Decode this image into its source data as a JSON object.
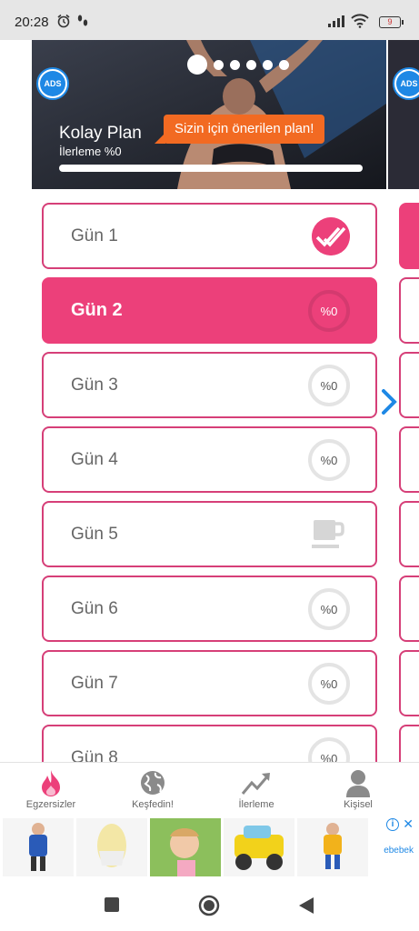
{
  "status_bar": {
    "time": "20:28",
    "battery": "9"
  },
  "carousel": {
    "ads_label": "ADS",
    "plan_name": "Kolay Plan",
    "progress_text": "İlerleme %0",
    "progress": 0,
    "recommendation": "Sizin için önerilen plan!",
    "page_count": 6,
    "active_page": 0
  },
  "days": [
    {
      "label": "Gün 1",
      "status": "done"
    },
    {
      "label": "Gün 2",
      "status": "active",
      "progress": "%0"
    },
    {
      "label": "Gün 3",
      "status": "progress",
      "progress": "%0"
    },
    {
      "label": "Gün 4",
      "status": "progress",
      "progress": "%0"
    },
    {
      "label": "Gün 5",
      "status": "rest"
    },
    {
      "label": "Gün 6",
      "status": "progress",
      "progress": "%0"
    },
    {
      "label": "Gün 7",
      "status": "progress",
      "progress": "%0"
    },
    {
      "label": "Gün 8",
      "status": "progress",
      "progress": "%0"
    }
  ],
  "bottom_nav": {
    "items": [
      {
        "label": "Egzersizler",
        "icon": "flame-icon",
        "active": true
      },
      {
        "label": "Keşfedin!",
        "icon": "globe-icon",
        "active": false
      },
      {
        "label": "İlerleme",
        "icon": "trend-icon",
        "active": false
      },
      {
        "label": "Kişisel",
        "icon": "person-icon",
        "active": false
      }
    ]
  },
  "ad": {
    "brand": "ebebek",
    "info": "i",
    "close": "✕"
  },
  "colors": {
    "accent": "#ec407a",
    "orange": "#f26a22",
    "blue": "#1e88e5"
  }
}
